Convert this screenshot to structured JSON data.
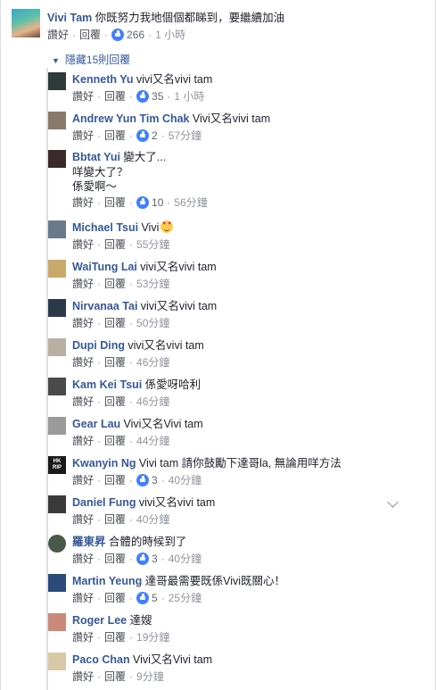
{
  "top_comment": {
    "author": "Vivi Tam",
    "text": "你既努力我地個個都睇到，要繼續加油",
    "like_action": "讚好",
    "reply_action": "回覆",
    "likes": "266",
    "time": "1 小時"
  },
  "hidden_replies_link": "隱藏15則回覆",
  "replies": [
    {
      "author": "Kenneth Yu",
      "text": "vivi又名vivi tam",
      "like_action": "讚好",
      "reply_action": "回覆",
      "likes": "35",
      "time": "1 小時",
      "avatar_color": "#2f3a3a"
    },
    {
      "author": "Andrew Yun Tim Chak",
      "text": "Vivi又名vivi tam",
      "like_action": "讚好",
      "reply_action": "回覆",
      "likes": "2",
      "time": "57分鐘",
      "avatar_color": "#8a7a6a"
    },
    {
      "author": "Bbtat Yui",
      "text": "變大了...",
      "text_line2": "咩變大了？",
      "text_line3": "係愛啊～",
      "like_action": "讚好",
      "reply_action": "回覆",
      "likes": "10",
      "time": "56分鐘",
      "avatar_color": "#3a2a2a"
    },
    {
      "author": "Michael Tsui",
      "text": "Vivi",
      "emoji": "heart-eyes-emoji",
      "like_action": "讚好",
      "reply_action": "回覆",
      "time": "55分鐘",
      "avatar_color": "#6a7a8a"
    },
    {
      "author": "WaiTung Lai",
      "text": "vivi又名vivi tam",
      "like_action": "讚好",
      "reply_action": "回覆",
      "time": "53分鐘",
      "avatar_color": "#c9a86a"
    },
    {
      "author": "Nirvanaa Tai",
      "text": "vivi又名vivi tam",
      "like_action": "讚好",
      "reply_action": "回覆",
      "time": "50分鐘",
      "avatar_color": "#2a3a4a"
    },
    {
      "author": "Dupi Ding",
      "text": "vivi又名vivi tam",
      "like_action": "讚好",
      "reply_action": "回覆",
      "time": "46分鐘",
      "avatar_color": "#b8b0a0"
    },
    {
      "author": "Kam Kei Tsui",
      "text": "係愛呀哈利",
      "like_action": "讚好",
      "reply_action": "回覆",
      "time": "46分鐘",
      "avatar_color": "#4a4a4a"
    },
    {
      "author": "Gear Lau",
      "text": "Vivi又名Vivi tam",
      "like_action": "讚好",
      "reply_action": "回覆",
      "time": "44分鐘",
      "avatar_color": "#9a9a9a"
    },
    {
      "author": "Kwanyin Ng",
      "text": "Vivi tam 請你鼓勵下達哥la, 無論用咩方法",
      "like_action": "讚好",
      "reply_action": "回覆",
      "likes": "3",
      "time": "40分鐘",
      "avatar_color": "#1a1a1a",
      "avatar_text": "HK RIP"
    },
    {
      "author": "Daniel Fung",
      "text": "vivi又名vivi tam",
      "like_action": "讚好",
      "reply_action": "回覆",
      "time": "40分鐘",
      "avatar_color": "#3a3a3a"
    },
    {
      "author": "羅東昇",
      "text": "合體的時候到了",
      "like_action": "讚好",
      "reply_action": "回覆",
      "likes": "3",
      "time": "40分鐘",
      "avatar_color": "#4a5a4a"
    },
    {
      "author": "Martin Yeung",
      "text": "達哥最需要既係Vivi既關心！",
      "like_action": "讚好",
      "reply_action": "回覆",
      "likes": "5",
      "time": "25分鐘",
      "avatar_color": "#2a4a7a"
    },
    {
      "author": "Roger Lee",
      "text": "達嫂",
      "like_action": "讚好",
      "reply_action": "回覆",
      "time": "19分鐘",
      "avatar_color": "#c98a7a"
    },
    {
      "author": "Paco Chan",
      "text": "Vivi又名Vivi tam",
      "like_action": "讚好",
      "reply_action": "回覆",
      "time": "9分鐘",
      "avatar_color": "#d8c8a8"
    }
  ],
  "colors": {
    "author": "#365899",
    "meta": "#90949c",
    "like_badge": "#4080ff"
  }
}
